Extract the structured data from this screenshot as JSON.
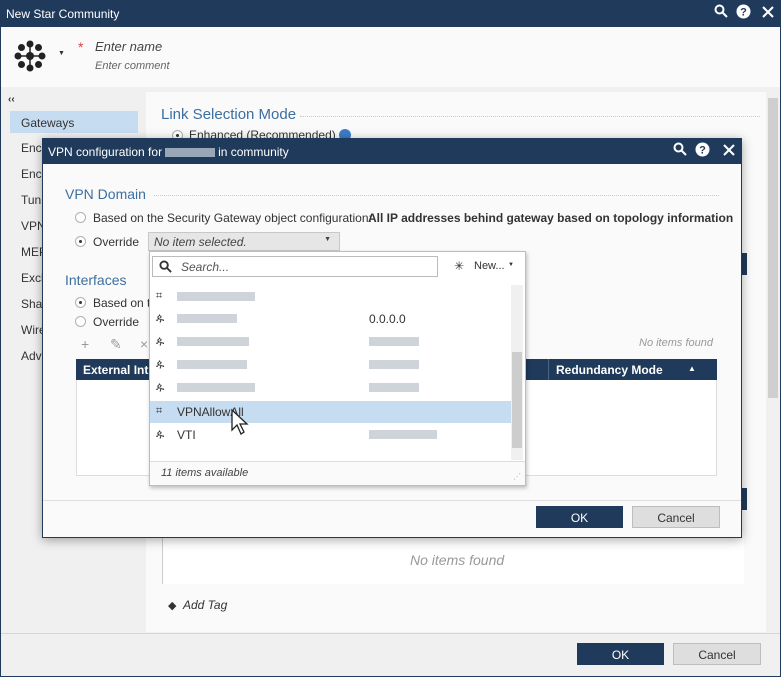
{
  "window": {
    "title": "New Star Community",
    "name_placeholder": "Enter name",
    "comment_placeholder": "Enter comment",
    "required_mark": "*"
  },
  "sidebar": {
    "collapse": "‹‹",
    "items": [
      {
        "label": "Gateways",
        "selected": true
      },
      {
        "label": "Encr"
      },
      {
        "label": "Encr"
      },
      {
        "label": "Tunn"
      },
      {
        "label": "VPN"
      },
      {
        "label": "MEP"
      },
      {
        "label": "Excl"
      },
      {
        "label": "Shar"
      },
      {
        "label": "Wire"
      },
      {
        "label": "Adv"
      }
    ]
  },
  "main": {
    "link_selection_title": "Link Selection Mode",
    "enhanced_option": "Enhanced (Recommended)",
    "no_items_lower": "No items found",
    "add_tag": "Add Tag",
    "ok": "OK",
    "cancel": "Cancel"
  },
  "dialog": {
    "title_prefix": "VPN configuration for",
    "title_suffix": "in  community",
    "vpn_domain_title": "VPN Domain",
    "based_on_label": "Based on the Security Gateway object configuration:",
    "based_on_value": "All IP addresses behind gateway based on topology information",
    "override_label": "Override",
    "combo_value": "No item selected.",
    "interfaces_title": "Interfaces",
    "if_based_on": "Based on th",
    "if_override": "Override",
    "no_items_found": "No items found",
    "col_external": "External Int",
    "col_redundancy": "Redundancy Mode",
    "sort_arrow": "▲",
    "ok": "OK",
    "cancel": "Cancel"
  },
  "dropdown": {
    "search_placeholder": "Search...",
    "new_button": "New...",
    "footer": "11 items available",
    "items": [
      {
        "name": "",
        "value": "",
        "icon": "group-icon"
      },
      {
        "name": "",
        "value": "0.0.0.0",
        "icon": "network-icon"
      },
      {
        "name": "",
        "value": "",
        "icon": "network-icon"
      },
      {
        "name": "",
        "value": "",
        "icon": "network-icon"
      },
      {
        "name": "",
        "value": "",
        "icon": "network-icon"
      },
      {
        "name": "VPNAllowAll",
        "value": "",
        "icon": "group-icon",
        "selected": true
      },
      {
        "name": "VTI",
        "value": "",
        "icon": "network-icon"
      }
    ]
  },
  "colors": {
    "titlebar": "#1f3a5a",
    "accent_text": "#3c6fa0",
    "selection": "#c6dcf0"
  }
}
